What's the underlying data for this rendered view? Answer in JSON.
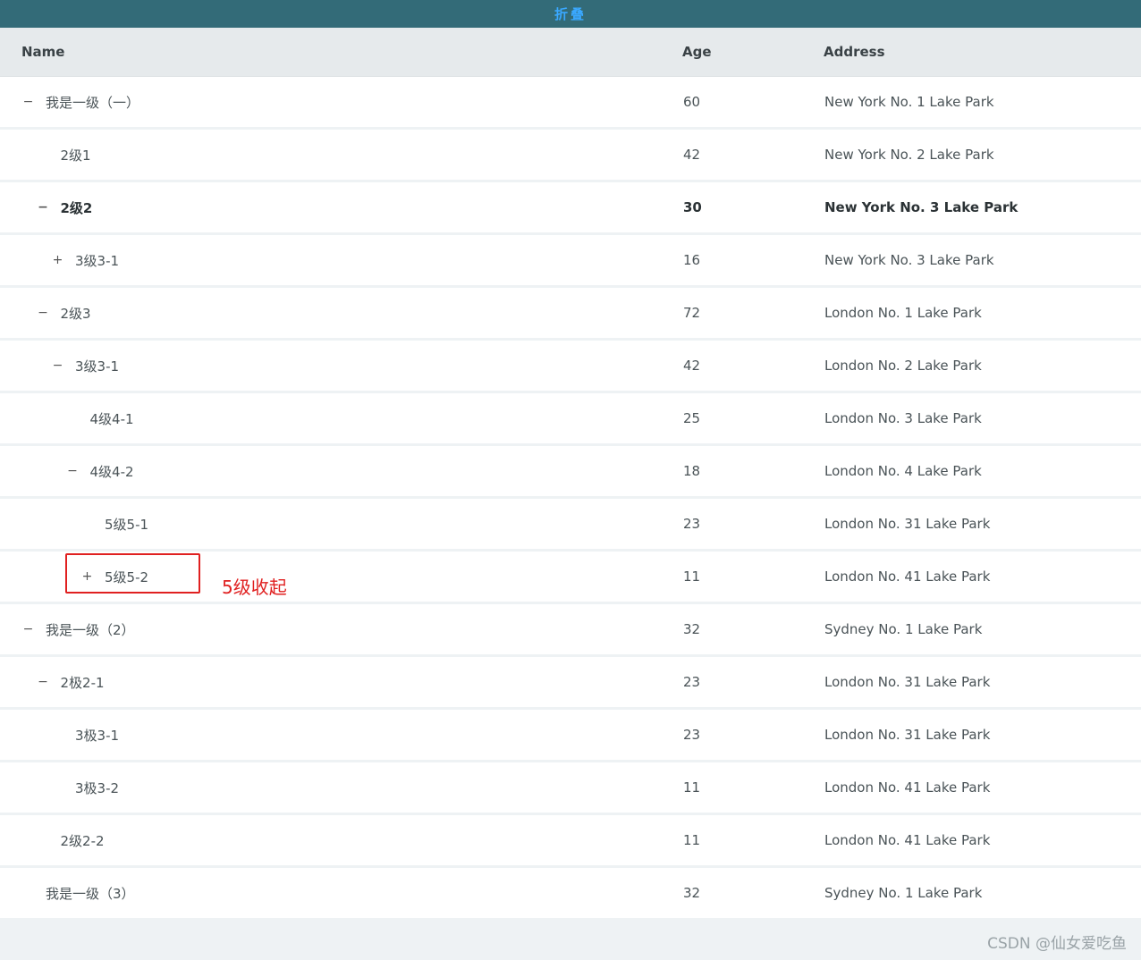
{
  "toolbar": {
    "collapse_label": "折叠"
  },
  "columns": {
    "name": "Name",
    "age": "Age",
    "address": "Address"
  },
  "rows": [
    {
      "name": "我是一级（一）",
      "age": "60",
      "address": "New York No. 1 Lake Park",
      "level": 0,
      "toggle": "−",
      "bold": false
    },
    {
      "name": "2级1",
      "age": "42",
      "address": "New York No. 2 Lake Park",
      "level": 1,
      "toggle": "",
      "bold": false
    },
    {
      "name": "2级2",
      "age": "30",
      "address": "New York No. 3 Lake Park",
      "level": 1,
      "toggle": "−",
      "bold": true
    },
    {
      "name": "3级3-1",
      "age": "16",
      "address": "New York No. 3 Lake Park",
      "level": 2,
      "toggle": "+",
      "bold": false
    },
    {
      "name": "2级3",
      "age": "72",
      "address": "London No. 1 Lake Park",
      "level": 1,
      "toggle": "−",
      "bold": false
    },
    {
      "name": "3级3-1",
      "age": "42",
      "address": "London No. 2 Lake Park",
      "level": 2,
      "toggle": "−",
      "bold": false
    },
    {
      "name": "4级4-1",
      "age": "25",
      "address": "London No. 3 Lake Park",
      "level": 3,
      "toggle": "",
      "bold": false
    },
    {
      "name": "4级4-2",
      "age": "18",
      "address": "London No. 4 Lake Park",
      "level": 3,
      "toggle": "−",
      "bold": false
    },
    {
      "name": "5级5-1",
      "age": "23",
      "address": "London No. 31 Lake Park",
      "level": 4,
      "toggle": "",
      "bold": false
    },
    {
      "name": "5级5-2",
      "age": "11",
      "address": "London No. 41 Lake Park",
      "level": 4,
      "toggle": "+",
      "bold": false
    },
    {
      "name": "我是一级（2）",
      "age": "32",
      "address": "Sydney No. 1 Lake Park",
      "level": 0,
      "toggle": "−",
      "bold": false
    },
    {
      "name": "2极2-1",
      "age": "23",
      "address": "London No. 31 Lake Park",
      "level": 1,
      "toggle": "−",
      "bold": false
    },
    {
      "name": "3极3-1",
      "age": "23",
      "address": "London No. 31 Lake Park",
      "level": 2,
      "toggle": "",
      "bold": false
    },
    {
      "name": "3极3-2",
      "age": "11",
      "address": "London No. 41 Lake Park",
      "level": 2,
      "toggle": "",
      "bold": false
    },
    {
      "name": "2级2-2",
      "age": "11",
      "address": "London No. 41 Lake Park",
      "level": 1,
      "toggle": "",
      "bold": false
    },
    {
      "name": "我是一级（3）",
      "age": "32",
      "address": "Sydney No. 1 Lake Park",
      "level": 0,
      "toggle": "",
      "bold": false
    }
  ],
  "annotation": {
    "text": "5级收起"
  },
  "watermark": "CSDN @仙女爱吃鱼",
  "colors": {
    "header_bar": "#336b78",
    "collapse_text": "#3aa8ff",
    "annotation": "#e02020"
  }
}
